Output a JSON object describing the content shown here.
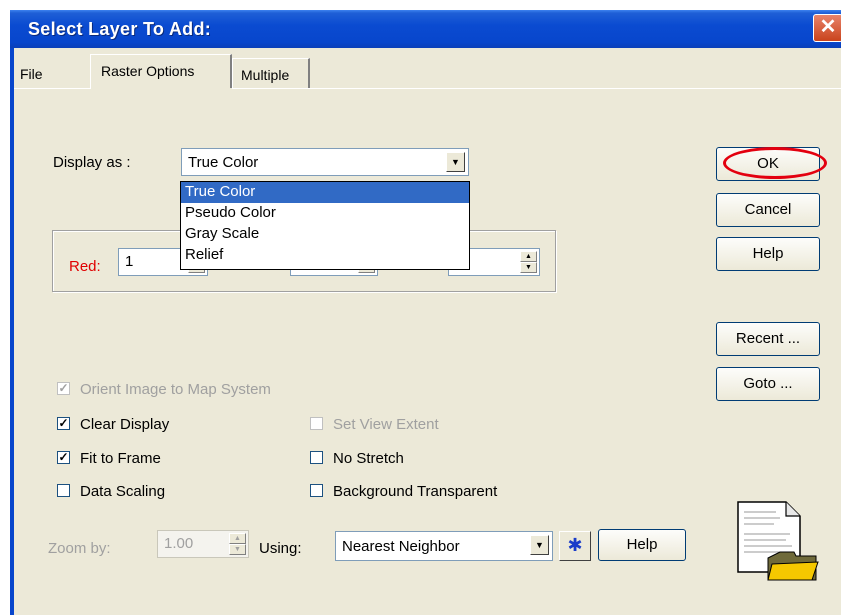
{
  "window": {
    "title": "Select Layer To Add:",
    "close_symbol": "✕"
  },
  "tabs": [
    {
      "label": "File",
      "active": false
    },
    {
      "label": "Raster Options",
      "active": true
    },
    {
      "label": "Multiple",
      "active": false
    }
  ],
  "display": {
    "label": "Display as :",
    "value": "True Color",
    "options": [
      "True Color",
      "Pseudo Color",
      "Gray Scale",
      "Relief"
    ],
    "selected_index": 0
  },
  "rgb": {
    "red_label": "Red:",
    "red_value": "1",
    "red_color": "#e00000"
  },
  "buttons": {
    "ok": "OK",
    "cancel": "Cancel",
    "help": "Help",
    "recent": "Recent ...",
    "goto": "Goto ..."
  },
  "checkboxes": {
    "orient": {
      "label": "Orient Image to Map System",
      "checked": true,
      "disabled": true
    },
    "clear_display": {
      "label": "Clear Display",
      "checked": true,
      "disabled": false
    },
    "fit_to_frame": {
      "label": "Fit to Frame",
      "checked": true,
      "disabled": false
    },
    "data_scaling": {
      "label": "Data Scaling",
      "checked": false,
      "disabled": false
    },
    "set_view_extent": {
      "label": "Set View Extent",
      "checked": false,
      "disabled": true
    },
    "no_stretch": {
      "label": "No Stretch",
      "checked": false,
      "disabled": false
    },
    "background_transparent": {
      "label": "Background Transparent",
      "checked": false,
      "disabled": false
    }
  },
  "zoom": {
    "label": "Zoom by:",
    "value": "1.00",
    "using_label": "Using:",
    "resample_value": "Nearest Neighbor",
    "star_symbol": "✱",
    "help_label": "Help"
  },
  "icons": {
    "file_folder": "file-folder-icon"
  },
  "colors": {
    "titlebar": "#0a4bd1",
    "selection": "#316ac5",
    "highlight_circle": "#e3000f"
  }
}
